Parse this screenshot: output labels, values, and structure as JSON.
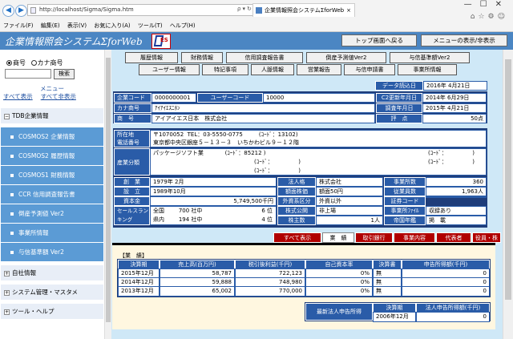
{
  "browser": {
    "url": "http://localhost/Sigma/Sigma.htm",
    "tab_title": "企業情報照会システムΣforWeb",
    "menu": [
      "ファイル(F)",
      "編集(E)",
      "表示(V)",
      "お気に入り(A)",
      "ツール(T)",
      "ヘルプ(H)"
    ],
    "back_icon": "◀",
    "forward_icon": "▶",
    "close_icon": "×",
    "window_controls": "—☐✕",
    "addr_controls": "ρ▾↻",
    "right_icons": "⌂☆⚙☺"
  },
  "header": {
    "title": "企業情報照会システムΣforWeb",
    "logo_text": "ES",
    "top_button": "トップ画面へ戻る",
    "menu_toggle_button": "メニューの表示/非表示"
  },
  "sidebar": {
    "radio_code": "商号",
    "radio_kana": "カナ商号",
    "search_button": "検索",
    "search_value": "",
    "menu_heading": "メニュー",
    "show_all": "すべて表示",
    "hide_all": "すべて非表示",
    "groups": [
      {
        "label": "TDB企業情報",
        "sign": "−"
      },
      {
        "label": "自社情報",
        "sign": "+"
      },
      {
        "label": "システム管理・マスタメ",
        "sign": "+"
      },
      {
        "label": "ツール・ヘルプ",
        "sign": "+"
      }
    ],
    "items": [
      "COSMOS2 企業情報",
      "COSMOS2 履歴情報",
      "COSMOS1 財務情報",
      "CCR 信用調査報告書",
      "倒産予測値 Ver2",
      "事業所情報",
      "与信基準額 Ver2"
    ]
  },
  "tabs_row1": [
    "履歴情報",
    "財務情報",
    "信用調査報告書",
    "倒産予測値Ver2",
    "与信基準額Ver2"
  ],
  "tabs_row2": [
    "ユーザー情報",
    "特記事項",
    "人脈情報",
    "営業報告",
    "与信申請書",
    "事業所情報"
  ],
  "company": {
    "read_date_label": "データ読込日",
    "read_date": "2016年 4月21日",
    "company_code_label": "企業コード",
    "company_code": "0000000001",
    "user_code_label": "ユーザーコード",
    "user_code": "10000",
    "kana_label": "カナ商号",
    "kana": "ｱｲｱｲｴｽﾆﾎﾝ",
    "name_label": "商　号",
    "name": "アイアイエス日本　株式会社",
    "c2_update_label": "C2更新年月日",
    "c2_update": "2014年 6月29日",
    "survey_date_label": "調査年月日",
    "survey_date": "2015年 4月21日",
    "score_label": "評　点",
    "score": "50点",
    "addr_label": "所在地",
    "phone_label": "電話番号",
    "postal": "〒1070052",
    "tel": "TEL：03-5550-0775",
    "addr_code_label": "(ｺｰﾄﾞ：",
    "addr_code": "13102)",
    "address": "東京都中央区銀座５－１３－３　いちかわビル９－１２階",
    "industry_label": "産業分類",
    "industry": "パッケージソフト業",
    "industry_code": "(ｺｰﾄﾞ：85212 )",
    "empty_code": "(ｺｰﾄﾞ：　　　　　)",
    "founded_label": "創　業",
    "founded": "1979年 2月",
    "established_label": "設　立",
    "established": "1989年10月",
    "capital_label": "資本金",
    "capital": "5,749,500千円",
    "corp_label": "法人格",
    "corp": "株式会社",
    "par_label": "額面株価",
    "par": "額面50円",
    "foreign_label": "外資系区分",
    "foreign": "外資以外",
    "listed_label": "株式公開",
    "listed": "非上場",
    "shareholders_label": "株主数",
    "shareholders": "1人",
    "offices_label": "事業所数",
    "offices": "360",
    "employees_label": "従業員数",
    "employees": "1,963人",
    "securities_label": "証券コード",
    "securities": "",
    "office_file_label": "事業所ﾌｧｲﾙ",
    "office_file": "収録あり",
    "imperial_label": "帝国年鑑",
    "imperial": "掲　載",
    "sales_rank_label": "セールスランキング",
    "rank_nation_label": "全国",
    "rank_nation": "700 社中",
    "rank_nation_pos": "6 位",
    "rank_pref_label": "県内",
    "rank_pref": "194 社中",
    "rank_pref_pos": "4 位"
  },
  "detail_tabs": [
    "すべて表示",
    "業　績",
    "取引銀行",
    "事業内容",
    "代表者",
    "役員・株主"
  ],
  "performance": {
    "title": "【業　績】",
    "headers": [
      "決算期",
      "売上高(百万円)",
      "税引後利益(千円)",
      "自己資本率",
      "決算書",
      "申告所得額(千円)"
    ],
    "rows": [
      [
        "2015年12月",
        "58,787",
        "722,123",
        "0%",
        "無",
        "0"
      ],
      [
        "2014年12月",
        "59,888",
        "748,980",
        "0%",
        "無",
        "0"
      ],
      [
        "2013年12月",
        "65,002",
        "770,000",
        "0%",
        "無",
        "0"
      ]
    ],
    "latest_label": "最新法人申告所得",
    "latest_headers": [
      "決算期",
      "法人申告所得額(千円)"
    ],
    "latest_row": [
      "2006年12月",
      "0"
    ]
  }
}
